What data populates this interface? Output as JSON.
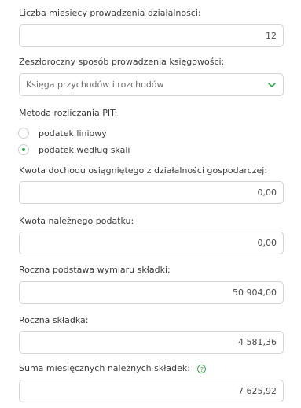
{
  "months": {
    "label": "Liczba miesięcy prowadzenia działalności:",
    "value": "12"
  },
  "accounting": {
    "label": "Zeszłoroczny sposób prowadzenia księgowości:",
    "selected": "Księga przychodów i rozchodów",
    "icon": "chevron-down-icon"
  },
  "pit": {
    "label": "Metoda rozliczania PIT:",
    "options": [
      {
        "label": "podatek liniowy",
        "checked": false
      },
      {
        "label": "podatek według skali",
        "checked": true
      }
    ]
  },
  "income": {
    "label": "Kwota dochodu osiągniętego z działalności gospodarczej:",
    "value": "0,00"
  },
  "tax": {
    "label": "Kwota należnego podatku:",
    "value": "0,00"
  },
  "base": {
    "label": "Roczna podstawa wymiaru składki:",
    "value": "50 904,00"
  },
  "contribution": {
    "label": "Roczna składka:",
    "value": "4 581,36"
  },
  "monthly_sum": {
    "label": "Suma miesięcznych należnych składek:",
    "value": "7 625,92",
    "help_icon": "?"
  },
  "colors": {
    "accent": "#2fa64a",
    "border": "#d3d3d3"
  }
}
